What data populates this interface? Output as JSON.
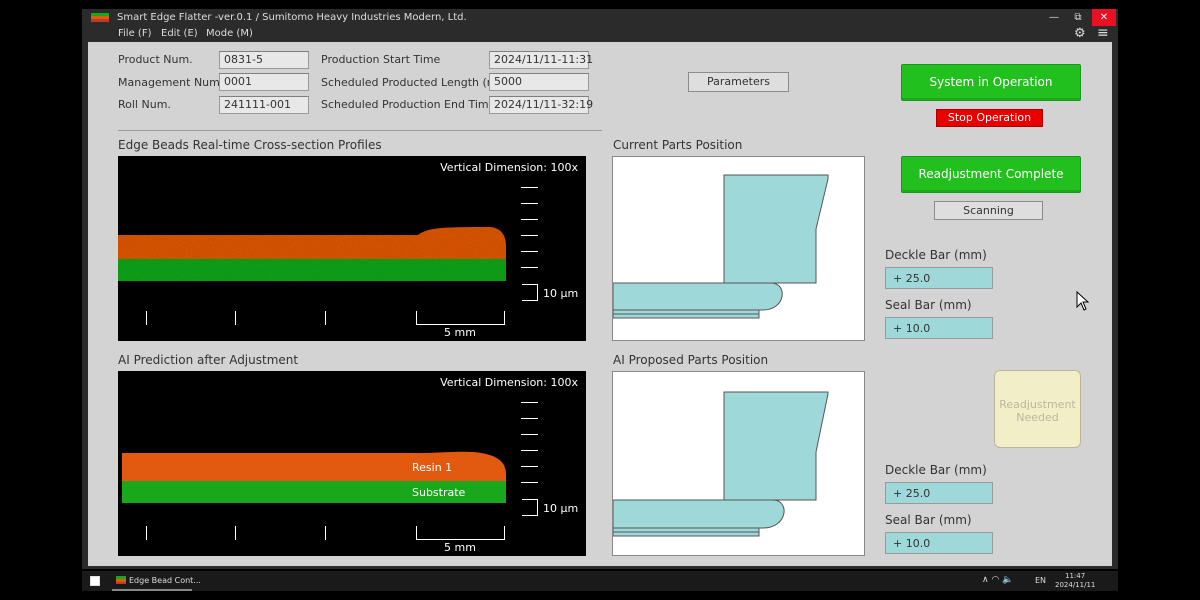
{
  "window": {
    "title": "Smart Edge Flatter -ver.0.1 / Sumitomo Heavy Industries Modern, Ltd.",
    "minimize_glyph": "—",
    "restore_glyph": "⧉",
    "close_glyph": "✕"
  },
  "menu": {
    "items": [
      "File (F)",
      "Edit (E)",
      "Mode (M)"
    ],
    "settings_glyph": "⚙",
    "hamburger_glyph": "≡"
  },
  "info": {
    "product_num_label": "Product Num.",
    "product_num": "0831-5",
    "management_num_label": "Management Num.",
    "management_num": "0001",
    "roll_num_label": "Roll Num.",
    "roll_num": "241111-001",
    "start_time_label": "Production Start Time",
    "start_time": "2024/11/11-11:31",
    "length_label": "Scheduled Producted Length (m)",
    "length": "5000",
    "end_time_label": "Scheduled Production End Time",
    "end_time": "2024/11/11-32:19"
  },
  "parameters_button": "Parameters",
  "realtime": {
    "title": "Edge Beads Real-time Cross-section Profiles",
    "vertical_dimension": "Vertical Dimension: 100x",
    "scale_um": "10 µm",
    "scale_mm": "5 mm"
  },
  "prediction": {
    "title": "AI Prediction after Adjustment",
    "vertical_dimension": "Vertical Dimension: 100x",
    "resin_label": "Resin 1",
    "substrate_label": "Substrate",
    "scale_um": "10 µm",
    "scale_mm": "5 mm"
  },
  "current_parts": {
    "title": "Current Parts Position"
  },
  "proposed_parts": {
    "title": "AI Proposed Parts Position"
  },
  "controls": {
    "system_status": "System in Operation",
    "stop_button": "Stop Operation",
    "readjust_complete": "Readjustment Complete",
    "scanning": "Scanning",
    "readjust_needed": "Readjustment Needed"
  },
  "current_values": {
    "deckle_label": "Deckle Bar (mm)",
    "deckle": "+ 25.0",
    "seal_label": "Seal Bar (mm)",
    "seal": "+ 10.0"
  },
  "proposed_values": {
    "deckle_label": "Deckle Bar (mm)",
    "deckle": "+ 25.0",
    "seal_label": "Seal Bar (mm)",
    "seal": "+ 10.0"
  },
  "colors": {
    "resin": "#e25a10",
    "substrate": "#19a81c",
    "part_fill": "#9ed8d8",
    "accent_green": "#22c01e"
  },
  "taskbar": {
    "app_label": "Edge Bead Cont...",
    "language": "EN",
    "time": "11:47",
    "date": "2024/11/11",
    "tray_glyphs": "∧ ◠ 🔈"
  }
}
